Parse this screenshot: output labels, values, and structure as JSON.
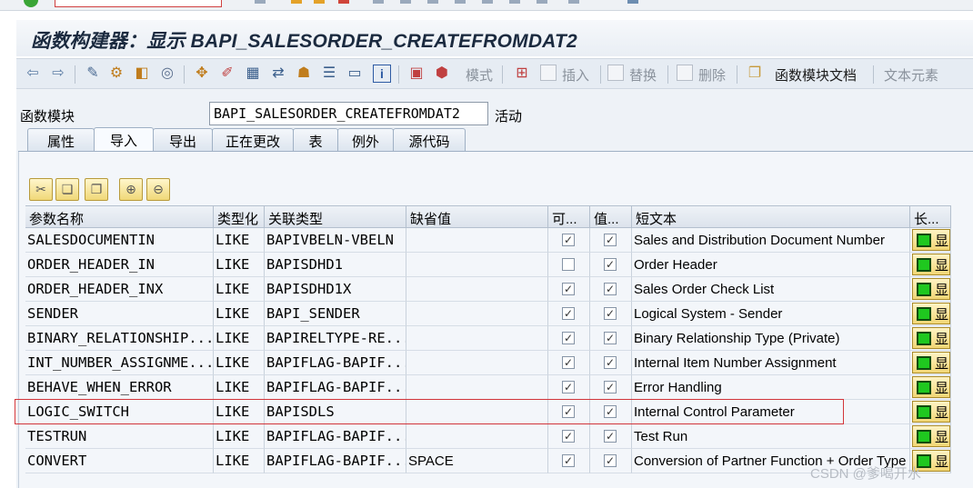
{
  "window": {
    "title": "函数构建器：显示 BAPI_SALESORDER_CREATEFROMDAT2"
  },
  "toolbar": {
    "pattern": "模式",
    "insert": "插入",
    "replace": "替换",
    "delete": "删除",
    "fm_doc": "函数模块文档",
    "text_elements": "文本元素"
  },
  "function_module": {
    "label": "函数模块",
    "value": "BAPI_SALESORDER_CREATEFROMDAT2",
    "status": "活动"
  },
  "tabs": [
    "属性",
    "导入",
    "导出",
    "正在更改",
    "表",
    "例外",
    "源代码"
  ],
  "active_tab": "导入",
  "table": {
    "headers": [
      "参数名称",
      "类型化",
      "关联类型",
      "缺省值",
      "可...",
      "值...",
      "短文本",
      "长..."
    ],
    "rows": [
      {
        "name": "SALESDOCUMENTIN",
        "typing": "LIKE",
        "ref_type": "BAPIVBELN-VBELN",
        "default": "",
        "optional": true,
        "pass_value": true,
        "short_text": "Sales and Distribution Document Number",
        "long": "显"
      },
      {
        "name": "ORDER_HEADER_IN",
        "typing": "LIKE",
        "ref_type": "BAPISDHD1",
        "default": "",
        "optional": false,
        "pass_value": true,
        "short_text": "Order Header",
        "long": "显"
      },
      {
        "name": "ORDER_HEADER_INX",
        "typing": "LIKE",
        "ref_type": "BAPISDHD1X",
        "default": "",
        "optional": true,
        "pass_value": true,
        "short_text": "Sales Order Check List",
        "long": "显"
      },
      {
        "name": "SENDER",
        "typing": "LIKE",
        "ref_type": "BAPI_SENDER",
        "default": "",
        "optional": true,
        "pass_value": true,
        "short_text": "Logical System - Sender",
        "long": "显"
      },
      {
        "name": "BINARY_RELATIONSHIP...",
        "typing": "LIKE",
        "ref_type": "BAPIRELTYPE-RE...",
        "default": "",
        "optional": true,
        "pass_value": true,
        "short_text": "Binary Relationship Type (Private)",
        "long": "显"
      },
      {
        "name": "INT_NUMBER_ASSIGNME...",
        "typing": "LIKE",
        "ref_type": "BAPIFLAG-BAPIF...",
        "default": "",
        "optional": true,
        "pass_value": true,
        "short_text": "Internal Item Number Assignment",
        "long": "显"
      },
      {
        "name": "BEHAVE_WHEN_ERROR",
        "typing": "LIKE",
        "ref_type": "BAPIFLAG-BAPIF...",
        "default": "",
        "optional": true,
        "pass_value": true,
        "short_text": "Error Handling",
        "long": "显"
      },
      {
        "name": "LOGIC_SWITCH",
        "typing": "LIKE",
        "ref_type": "BAPISDLS",
        "default": "",
        "optional": true,
        "pass_value": true,
        "short_text": "Internal Control Parameter",
        "long": "显"
      },
      {
        "name": "TESTRUN",
        "typing": "LIKE",
        "ref_type": "BAPIFLAG-BAPIF...",
        "default": "",
        "optional": true,
        "pass_value": true,
        "short_text": "Test Run",
        "long": "显"
      },
      {
        "name": "CONVERT",
        "typing": "LIKE",
        "ref_type": "BAPIFLAG-BAPIF...",
        "default": "SPACE",
        "optional": true,
        "pass_value": true,
        "short_text": "Conversion of Partner Function + Order Type",
        "long": "显"
      }
    ]
  },
  "watermark": "CSDN @爹喝开水"
}
